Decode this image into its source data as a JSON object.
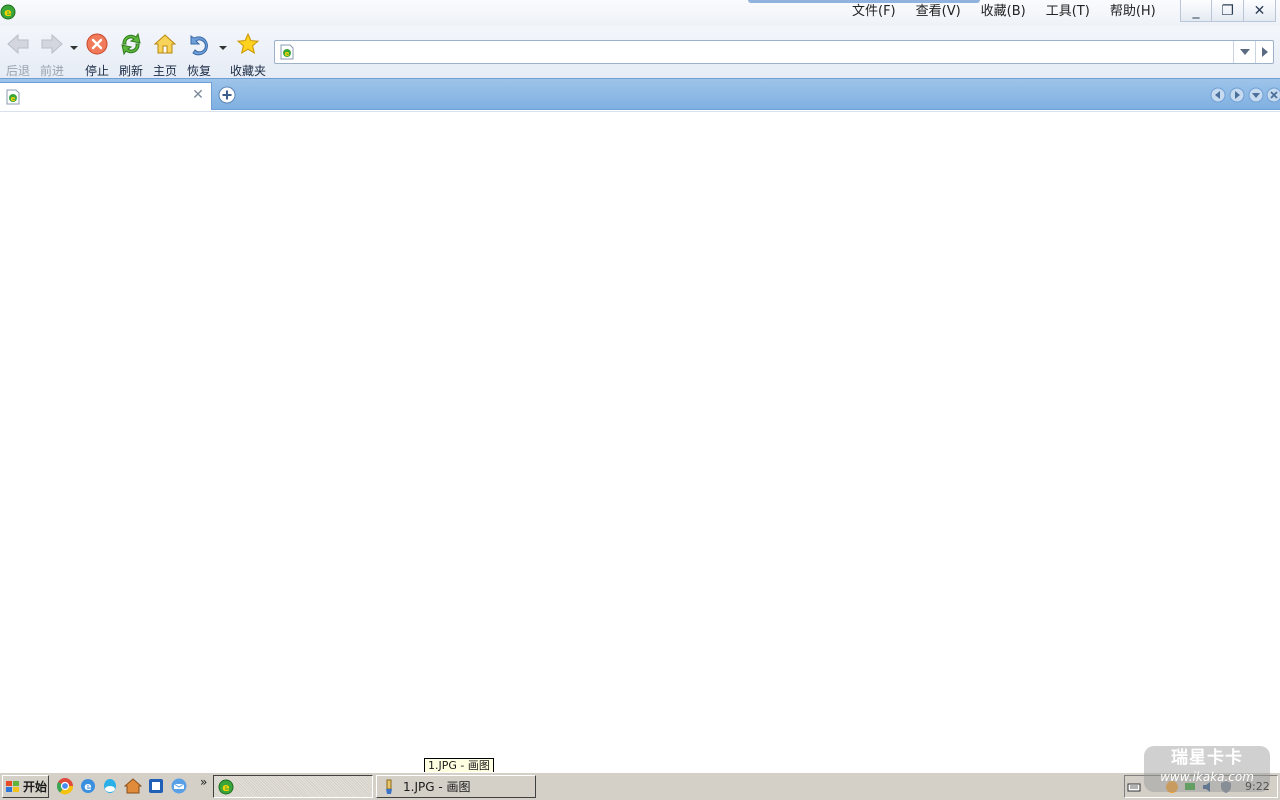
{
  "menu": {
    "items": [
      {
        "label": "文件(F)"
      },
      {
        "label": "查看(V)"
      },
      {
        "label": "收藏(B)"
      },
      {
        "label": "工具(T)"
      },
      {
        "label": "帮助(H)"
      }
    ]
  },
  "window_controls": {
    "minimize": "_",
    "restore": "❐",
    "close": "✕"
  },
  "toolbar": {
    "back": "后退",
    "forward": "前进",
    "stop": "停止",
    "refresh": "刷新",
    "home": "主页",
    "restore": "恢复",
    "favorites": "收藏夹"
  },
  "address_bar": {
    "value": "",
    "placeholder": ""
  },
  "tabs": [
    {
      "title": "",
      "close": "✕"
    }
  ],
  "tooltip": {
    "text": "1.JPG - 画图"
  },
  "taskbar": {
    "start_label": "开始",
    "more": "»",
    "tasks": [
      {
        "label": ""
      },
      {
        "label": "1.JPG - 画图"
      }
    ],
    "clock": "9:22"
  },
  "watermark": {
    "title": "瑞星卡卡",
    "url": "www.ikaka.com"
  },
  "colors": {
    "accent": "#80b0e1",
    "tab_bar": "#9ec4ea",
    "taskbar": "#d4d0c8"
  }
}
